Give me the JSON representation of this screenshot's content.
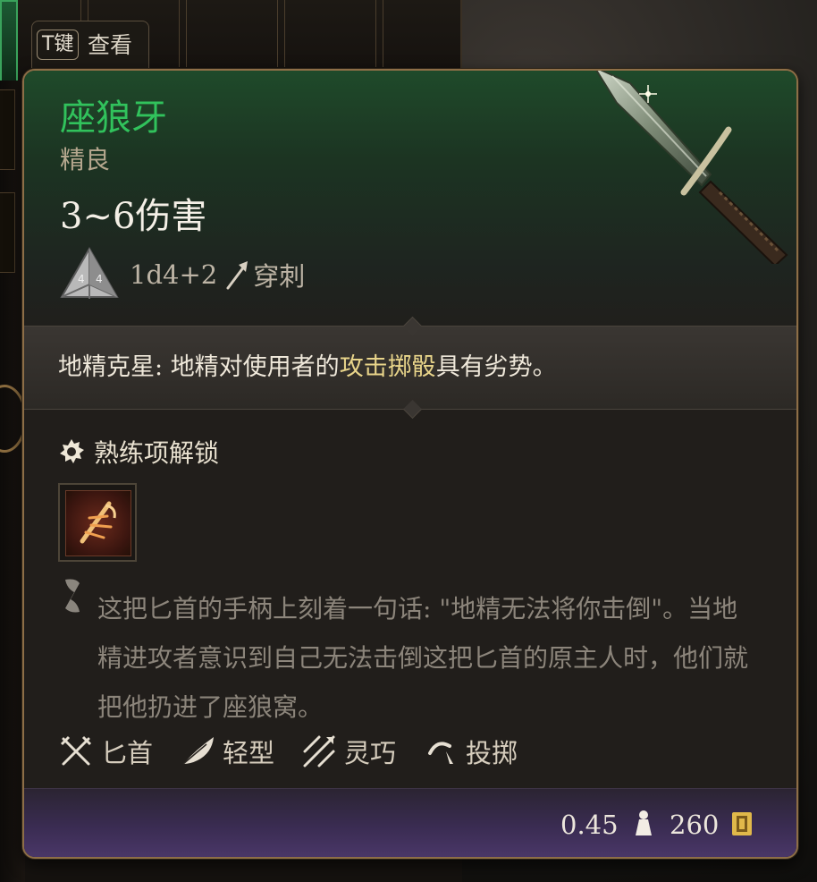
{
  "hint": {
    "key": "T键",
    "label": "查看"
  },
  "item": {
    "name": "座狼牙",
    "rarity": "精良",
    "damage": "3~6伤害",
    "dice_formula": "1d4+2",
    "damage_type": "穿刺"
  },
  "passive": {
    "name": "地精克星: ",
    "text_before": "地精对使用者的",
    "highlight": "攻击掷骰",
    "text_after": "具有劣势。"
  },
  "proficiency": {
    "label": "熟练项解锁"
  },
  "lore": "这把匕首的手柄上刻着一句话: \"地精无法将你击倒\"。当地精进攻者意识到自己无法击倒这把匕首的原主人时，他们就把他扔进了座狼窝。",
  "traits": [
    {
      "label": "匕首",
      "icon": "dagger-icon"
    },
    {
      "label": "轻型",
      "icon": "feather-icon"
    },
    {
      "label": "灵巧",
      "icon": "finesse-icon"
    },
    {
      "label": "投掷",
      "icon": "throw-icon"
    }
  ],
  "footer": {
    "weight": "0.45",
    "value": "260"
  },
  "colors": {
    "name": "#31c25c",
    "rarity": "#b5a78e",
    "highlight": "#e8d48a",
    "border": "#8d6e47",
    "footer": "#3a2c52"
  }
}
